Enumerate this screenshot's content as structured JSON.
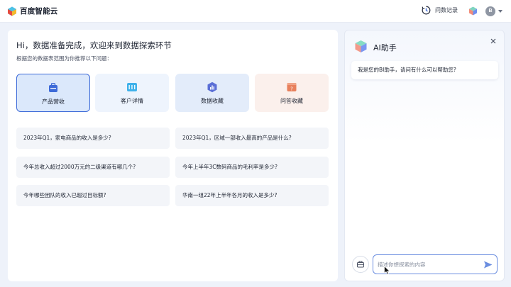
{
  "header": {
    "brand_name": "百度智能云",
    "history_label": "问数记录",
    "avatar_initial": "B"
  },
  "main": {
    "greeting": "Hi，数据准备完成，欢迎来到数据探索环节",
    "subline": "根据您的数据表范围为你推荐以下问题：",
    "categories": [
      {
        "label": "产品营收",
        "icon": "briefcase-icon",
        "color": "#3d6ad8"
      },
      {
        "label": "客户详情",
        "icon": "table-icon",
        "color": "#3fb1ea"
      },
      {
        "label": "数据收藏",
        "icon": "hexagon-chart-icon",
        "color": "#5b6fd6"
      },
      {
        "label": "问答收藏",
        "icon": "question-card-icon",
        "color": "#e8805c"
      }
    ],
    "questions": [
      "2023年Q1，家电商品的收入是多少?",
      "2023年Q1，区域一部收入最高的产品是什么?",
      "今年总收入超过2000万元的二级渠道有哪几个?",
      "今年上半年3C数码商品的毛利率是多少?",
      "今年哪些团队的收入已超过目标额?",
      "华南一组22年上半年各月的收入是多少?"
    ]
  },
  "ai_panel": {
    "title": "AI助手",
    "welcome": "我是您的BI助手，请问有什么可以帮助您?",
    "input_placeholder": "描述你想探索的内容"
  },
  "colors": {
    "accent": "#3d6ad8",
    "selected_bg": "#dbe8fb"
  }
}
